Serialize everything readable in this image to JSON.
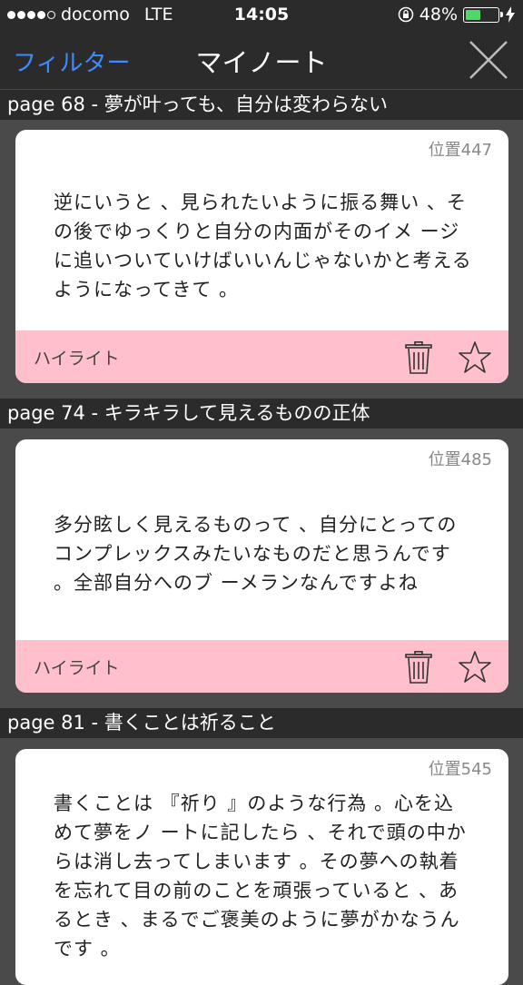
{
  "status_bar": {
    "carrier": "docomo",
    "network": "LTE",
    "time": "14:05",
    "battery_percent": "48%",
    "battery_level": 0.48,
    "signal_bars": 4
  },
  "nav": {
    "filter_label": "フィルター",
    "title": "マイノート",
    "close_icon": "close-icon"
  },
  "notes": [
    {
      "header": "page 68 - 夢が叶っても、自分は変わらない",
      "position": "位置447",
      "text": "逆にいうと 、見られたいように振る舞い 、その後でゆっくりと自分の内面がそのイメ ージに追いついていけばいいんじゃないかと考えるようになってきて 。",
      "type": "ハイライト"
    },
    {
      "header": "page 74 - キラキラして見えるものの正体",
      "position": "位置485",
      "text": "多分眩しく見えるものって 、自分にとってのコンプレックスみたいなものだと思うんです 。全部自分へのブ ーメランなんですよね",
      "type": "ハイライト"
    },
    {
      "header": "page 81 - 書くことは祈ること",
      "position": "位置545",
      "text": "書くことは 『祈り 』のような行為 。心を込めて夢をノ ートに記したら 、それで頭の中からは消し去ってしまいます 。その夢への執着を忘れて目の前のことを頑張っていると 、あるとき 、まるでご褒美のように夢がかなうんです 。",
      "type": ""
    }
  ],
  "colors": {
    "bar_bg": "#2b2b2b",
    "page_bg": "#4a4a4a",
    "accent_blue": "#3d8bff",
    "highlight_pink": "#ffc0cb",
    "battery_green": "#4cd964"
  }
}
